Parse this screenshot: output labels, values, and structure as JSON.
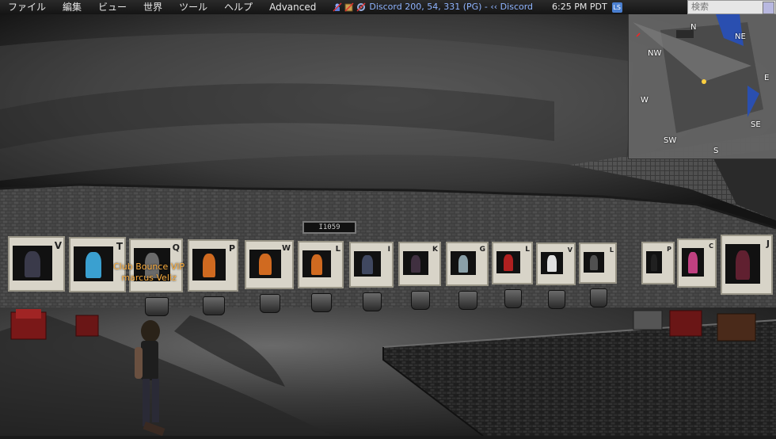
{
  "menu": {
    "items": [
      "ファイル",
      "編集",
      "ビュー",
      "世界",
      "ツール",
      "ヘルプ",
      "Advanced"
    ]
  },
  "status": {
    "location": "Discord 200, 54, 331 (PG) - ‹‹ Discord",
    "time": "6:25 PM PDT",
    "ls_label": "LS"
  },
  "search": {
    "placeholder": "検索"
  },
  "minimap": {
    "compass": {
      "n": "N",
      "ne": "NE",
      "e": "E",
      "se": "SE",
      "s": "S",
      "sw": "SW",
      "w": "W",
      "nw": "NW"
    }
  },
  "avatar": {
    "group_tag": "Club Bounce VIP",
    "name": "marcus Veliz"
  },
  "counter": {
    "value": "I1059"
  },
  "letters": [
    "V",
    "T",
    "Q",
    "P",
    "W",
    "L",
    "I",
    "K",
    "G",
    "L",
    "V",
    "L",
    "P",
    "C",
    "J"
  ],
  "colors": {
    "menubar": "#1e1e1e",
    "menu_text": "#e8e8e8",
    "location_text": "#8fb4ff",
    "nametag": "#ffb040",
    "minimap_bg": "#5a5a5a"
  }
}
